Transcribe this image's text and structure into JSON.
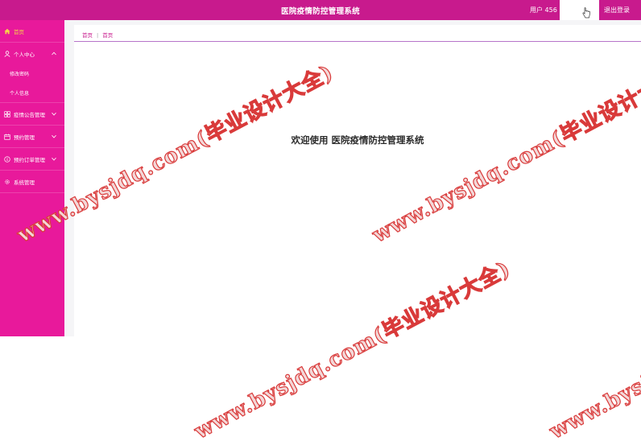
{
  "header": {
    "title": "医院疫情防控管理系统",
    "user_label": "用户 456",
    "logout_label": "退出登录",
    "bg_color": "#c81a8d"
  },
  "sidebar": {
    "bg_color": "#e8199b",
    "items": [
      {
        "label": "首页",
        "icon": "home-icon",
        "active": true
      },
      {
        "label": "个人中心",
        "icon": "user-icon",
        "expanded": true,
        "children": [
          {
            "label": "修改密码"
          },
          {
            "label": "个人信息"
          }
        ]
      },
      {
        "label": "疫情公告管理",
        "icon": "grid-icon"
      },
      {
        "label": "预约管理",
        "icon": "calendar-icon"
      },
      {
        "label": "预约订单管理",
        "icon": "info-icon"
      },
      {
        "label": "系统管理",
        "icon": "gear-icon"
      }
    ]
  },
  "breadcrumb": {
    "home": "首页",
    "current": "首页"
  },
  "main": {
    "welcome": "欢迎使用 医院疫情防控管理系统"
  },
  "watermark": {
    "text": "www.bysjdq.com(毕业设计大全)"
  }
}
